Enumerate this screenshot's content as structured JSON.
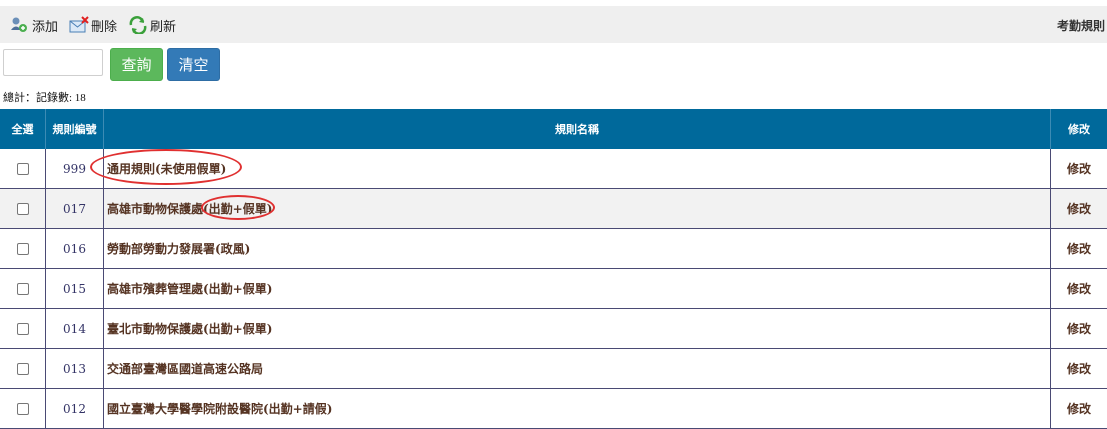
{
  "toolbar": {
    "add_label": "添加",
    "delete_label": "刪除",
    "refresh_label": "刷新",
    "page_title": "考勤規則"
  },
  "search": {
    "value": "",
    "query_label": "查詢",
    "clear_label": "清空"
  },
  "summary": "總計：記錄數: 18",
  "table": {
    "headers": {
      "select_all": "全選",
      "rule_code": "規則編號",
      "rule_name": "規則名稱",
      "edit": "修改"
    },
    "rows": [
      {
        "code": "999",
        "name": "通用規則(未使用假單)",
        "edit": "修改"
      },
      {
        "code": "017",
        "name": "高雄市動物保護處(出勤+假單)",
        "edit": "修改"
      },
      {
        "code": "016",
        "name": "勞動部勞動力發展署(政風)",
        "edit": "修改"
      },
      {
        "code": "015",
        "name": "高雄市殯葬管理處(出勤+假單)",
        "edit": "修改"
      },
      {
        "code": "014",
        "name": "臺北市動物保護處(出勤+假單)",
        "edit": "修改"
      },
      {
        "code": "013",
        "name": "交通部臺灣區國道高速公路局",
        "edit": "修改"
      },
      {
        "code": "012",
        "name": "國立臺灣大學醫學院附設醫院(出勤+請假)",
        "edit": "修改"
      }
    ]
  },
  "colors": {
    "header_bg": "#00699b",
    "query_btn": "#5cb85c",
    "clear_btn": "#337ab7",
    "annotation": "#e03030"
  }
}
